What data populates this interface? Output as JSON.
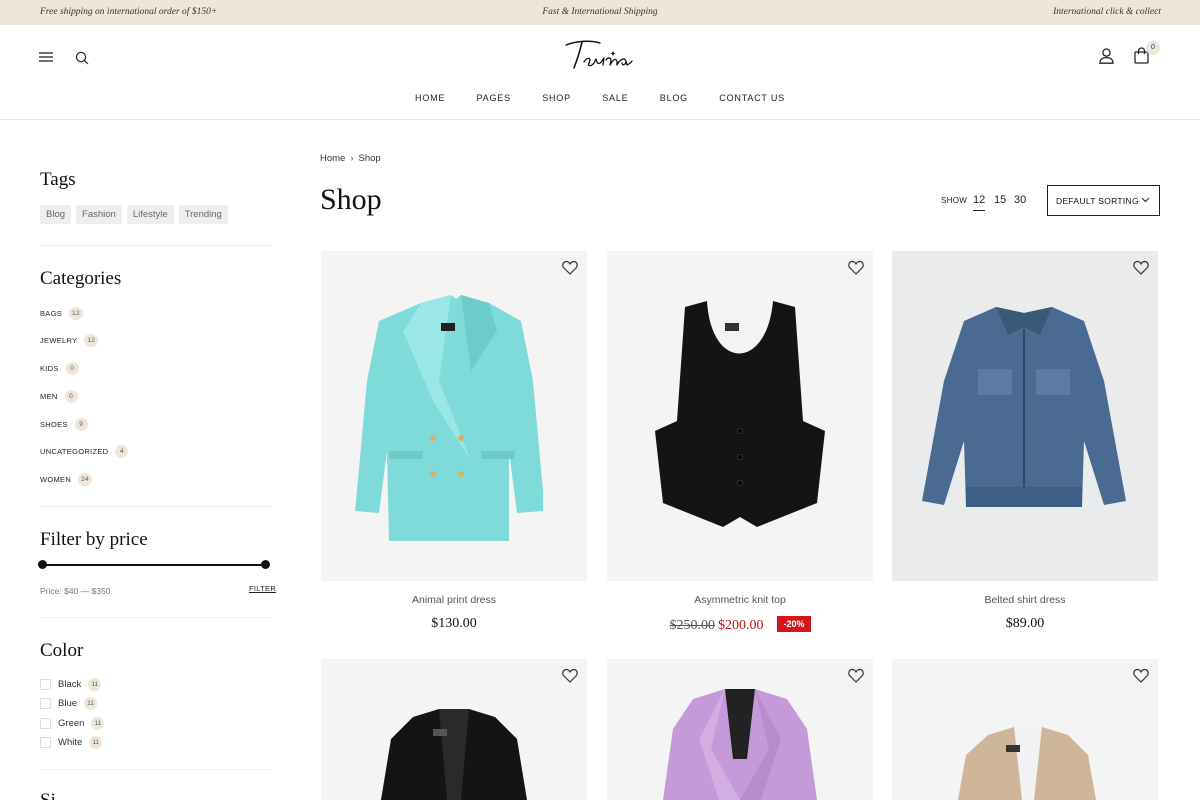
{
  "promo": {
    "left": "Free shipping on international order of $150+",
    "center": "Fast & International Shipping",
    "right": "International click & collect"
  },
  "header": {
    "logo": "Terina",
    "cart_count": "0",
    "nav": [
      "HOME",
      "PAGES",
      "SHOP",
      "SALE",
      "BLOG",
      "CONTACT US"
    ]
  },
  "sidebar": {
    "tags_title": "Tags",
    "tags": [
      "Blog",
      "Fashion",
      "Lifestyle",
      "Trending"
    ],
    "categories_title": "Categories",
    "categories": [
      {
        "name": "BAGS",
        "count": "12"
      },
      {
        "name": "JEWELRY",
        "count": "12"
      },
      {
        "name": "KIDS",
        "count": "0"
      },
      {
        "name": "MEN",
        "count": "0"
      },
      {
        "name": "SHOES",
        "count": "9"
      },
      {
        "name": "UNCATEGORIZED",
        "count": "4"
      },
      {
        "name": "WOMEN",
        "count": "24"
      }
    ],
    "price_title": "Filter by price",
    "price_label": "Price: $40 — $350",
    "filter_label": "FILTER",
    "price_range": {
      "min": 40,
      "max": 350,
      "selected_min_fraction": 0,
      "selected_max_fraction": 1
    },
    "color_title": "Color",
    "colors": [
      {
        "name": "Black",
        "count": "11"
      },
      {
        "name": "Blue",
        "count": "11"
      },
      {
        "name": "Green",
        "count": "11"
      },
      {
        "name": "White",
        "count": "11"
      }
    ],
    "next_title": "Si"
  },
  "main": {
    "breadcrumb": [
      "Home",
      "Shop"
    ],
    "title": "Shop",
    "show_label": "SHOW",
    "show_options": [
      "12",
      "15",
      "30"
    ],
    "show_selected": "12",
    "sort_label": "DEFAULT SORTING",
    "products": [
      {
        "name": "Animal print dress",
        "price": "$130.00",
        "garment": "aqua blazer",
        "color": "#7fdada"
      },
      {
        "name": "Asymmetric knit top",
        "old_price": "$250.00",
        "price": "$200.00",
        "badge": "-20%",
        "garment": "black vest",
        "color": "#141414"
      },
      {
        "name": "Belted shirt dress",
        "price": "$89.00",
        "garment": "denim jacket",
        "color": "#4a6a92"
      },
      {
        "garment": "black blazer",
        "color": "#141414"
      },
      {
        "garment": "lilac blazer",
        "color": "#c49ad8"
      },
      {
        "garment": "beige blazer",
        "color": "#cfb59a"
      }
    ]
  },
  "colors": {
    "accent_beige": "#efe6da",
    "sale_red": "#d01818"
  }
}
